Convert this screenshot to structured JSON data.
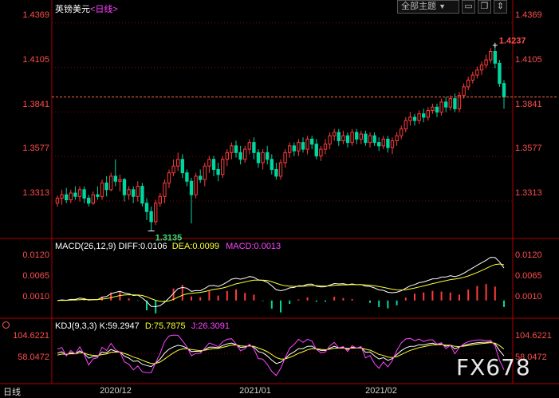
{
  "header": {
    "symbol": "英镑美元",
    "period": "<日线>",
    "theme_label": "全部主题",
    "theme_arrow": "▼",
    "btn_minus": "▭",
    "btn_copy": "❐",
    "btn_scroll": "⇕"
  },
  "footer": {
    "period_label": "日线"
  },
  "watermark": "FX678",
  "colors": {
    "up": "#ff3b3b",
    "down": "#00d6a0",
    "macd_white": "#ffffff",
    "macd_yellow": "#ffff33",
    "macd_magenta": "#ff44ff",
    "grid": "#8b0000",
    "axis_label": "#ff4d4d"
  },
  "chart_data": [
    {
      "type": "candlestick",
      "title": "英镑美元 <日线>",
      "yticks": [
        "1.4369",
        "1.4105",
        "1.3841",
        "1.3577",
        "1.3313"
      ],
      "ylim": [
        1.31,
        1.442
      ],
      "x_ticks": [
        "2020/12",
        "2021/01",
        "2021/02"
      ],
      "x_tick_index": [
        15,
        45,
        75
      ],
      "high_label": "1.4237",
      "low_label": "1.3135",
      "high_index": 98,
      "low_index": 21,
      "last_price": 1.393,
      "candles": [
        [
          1.33,
          1.333,
          1.328,
          1.3345
        ],
        [
          1.333,
          1.335,
          1.329,
          1.338
        ],
        [
          1.335,
          1.332,
          1.33,
          1.339
        ],
        [
          1.332,
          1.336,
          1.33,
          1.338
        ],
        [
          1.336,
          1.334,
          1.332,
          1.34
        ],
        [
          1.334,
          1.338,
          1.331,
          1.34
        ],
        [
          1.338,
          1.333,
          1.33,
          1.34
        ],
        [
          1.333,
          1.33,
          1.328,
          1.335
        ],
        [
          1.33,
          1.335,
          1.329,
          1.337
        ],
        [
          1.335,
          1.334,
          1.332,
          1.34
        ],
        [
          1.334,
          1.342,
          1.332,
          1.344
        ],
        [
          1.342,
          1.338,
          1.334,
          1.346
        ],
        [
          1.338,
          1.346,
          1.337,
          1.348
        ],
        [
          1.346,
          1.343,
          1.34,
          1.356
        ],
        [
          1.343,
          1.344,
          1.337,
          1.347
        ],
        [
          1.344,
          1.335,
          1.331,
          1.345
        ],
        [
          1.335,
          1.338,
          1.332,
          1.34
        ],
        [
          1.338,
          1.334,
          1.33,
          1.34
        ],
        [
          1.334,
          1.34,
          1.331,
          1.343
        ],
        [
          1.34,
          1.33,
          1.328,
          1.342
        ],
        [
          1.33,
          1.325,
          1.32,
          1.333
        ],
        [
          1.325,
          1.319,
          1.3135,
          1.328
        ],
        [
          1.319,
          1.33,
          1.317,
          1.332
        ],
        [
          1.33,
          1.334,
          1.328,
          1.336
        ],
        [
          1.334,
          1.342,
          1.33,
          1.344
        ],
        [
          1.342,
          1.348,
          1.339,
          1.35
        ],
        [
          1.348,
          1.352,
          1.346,
          1.356
        ],
        [
          1.352,
          1.356,
          1.349,
          1.36
        ],
        [
          1.356,
          1.348,
          1.345,
          1.359
        ],
        [
          1.348,
          1.343,
          1.34,
          1.35
        ],
        [
          1.343,
          1.335,
          1.318,
          1.345
        ],
        [
          1.335,
          1.346,
          1.333,
          1.348
        ],
        [
          1.346,
          1.344,
          1.342,
          1.35
        ],
        [
          1.344,
          1.352,
          1.34,
          1.354
        ],
        [
          1.352,
          1.356,
          1.348,
          1.358
        ],
        [
          1.356,
          1.35,
          1.346,
          1.358
        ],
        [
          1.35,
          1.347,
          1.343,
          1.354
        ],
        [
          1.347,
          1.356,
          1.345,
          1.358
        ],
        [
          1.356,
          1.36,
          1.352,
          1.362
        ],
        [
          1.36,
          1.364,
          1.356,
          1.366
        ],
        [
          1.364,
          1.36,
          1.357,
          1.367
        ],
        [
          1.36,
          1.356,
          1.353,
          1.364
        ],
        [
          1.356,
          1.362,
          1.354,
          1.364
        ],
        [
          1.362,
          1.366,
          1.359,
          1.368
        ],
        [
          1.366,
          1.36,
          1.356,
          1.369
        ],
        [
          1.36,
          1.354,
          1.351,
          1.362
        ],
        [
          1.354,
          1.36,
          1.35,
          1.362
        ],
        [
          1.36,
          1.356,
          1.353,
          1.364
        ],
        [
          1.356,
          1.35,
          1.347,
          1.359
        ],
        [
          1.35,
          1.346,
          1.344,
          1.354
        ],
        [
          1.346,
          1.354,
          1.344,
          1.356
        ],
        [
          1.354,
          1.36,
          1.351,
          1.362
        ],
        [
          1.36,
          1.364,
          1.357,
          1.366
        ],
        [
          1.364,
          1.361,
          1.358,
          1.366
        ],
        [
          1.361,
          1.366,
          1.358,
          1.368
        ],
        [
          1.366,
          1.362,
          1.36,
          1.369
        ],
        [
          1.362,
          1.368,
          1.359,
          1.37
        ],
        [
          1.368,
          1.365,
          1.362,
          1.37
        ],
        [
          1.365,
          1.358,
          1.356,
          1.368
        ],
        [
          1.358,
          1.362,
          1.355,
          1.364
        ],
        [
          1.362,
          1.365,
          1.359,
          1.368
        ],
        [
          1.365,
          1.37,
          1.362,
          1.372
        ],
        [
          1.37,
          1.372,
          1.367,
          1.374
        ],
        [
          1.372,
          1.367,
          1.364,
          1.374
        ],
        [
          1.367,
          1.37,
          1.365,
          1.373
        ],
        [
          1.37,
          1.366,
          1.363,
          1.372
        ],
        [
          1.366,
          1.372,
          1.364,
          1.374
        ],
        [
          1.372,
          1.368,
          1.365,
          1.374
        ],
        [
          1.368,
          1.371,
          1.365,
          1.373
        ],
        [
          1.371,
          1.366,
          1.364,
          1.373
        ],
        [
          1.366,
          1.37,
          1.363,
          1.372
        ],
        [
          1.37,
          1.366,
          1.364,
          1.372
        ],
        [
          1.366,
          1.364,
          1.361,
          1.369
        ],
        [
          1.364,
          1.368,
          1.362,
          1.37
        ],
        [
          1.368,
          1.363,
          1.36,
          1.37
        ],
        [
          1.363,
          1.367,
          1.359,
          1.369
        ],
        [
          1.367,
          1.37,
          1.364,
          1.372
        ],
        [
          1.37,
          1.374,
          1.368,
          1.376
        ],
        [
          1.374,
          1.379,
          1.372,
          1.381
        ],
        [
          1.379,
          1.381,
          1.376,
          1.384
        ],
        [
          1.381,
          1.379,
          1.376,
          1.383
        ],
        [
          1.379,
          1.383,
          1.377,
          1.385
        ],
        [
          1.383,
          1.381,
          1.378,
          1.386
        ],
        [
          1.381,
          1.385,
          1.379,
          1.387
        ],
        [
          1.385,
          1.387,
          1.383,
          1.389
        ],
        [
          1.387,
          1.384,
          1.381,
          1.389
        ],
        [
          1.384,
          1.39,
          1.382,
          1.392
        ],
        [
          1.39,
          1.387,
          1.384,
          1.393
        ],
        [
          1.387,
          1.392,
          1.385,
          1.394
        ],
        [
          1.392,
          1.386,
          1.384,
          1.395
        ],
        [
          1.386,
          1.394,
          1.384,
          1.396
        ],
        [
          1.394,
          1.399,
          1.392,
          1.401
        ],
        [
          1.399,
          1.403,
          1.397,
          1.405
        ],
        [
          1.403,
          1.406,
          1.401,
          1.408
        ],
        [
          1.406,
          1.409,
          1.404,
          1.411
        ],
        [
          1.409,
          1.412,
          1.406,
          1.414
        ],
        [
          1.412,
          1.415,
          1.41,
          1.418
        ],
        [
          1.415,
          1.42,
          1.413,
          1.422
        ],
        [
          1.42,
          1.413,
          1.41,
          1.4237
        ],
        [
          1.413,
          1.401,
          1.399,
          1.415
        ],
        [
          1.401,
          1.393,
          1.386,
          1.403
        ]
      ]
    },
    {
      "type": "macd",
      "title": "MACD(26,12,9)",
      "diff_label": "DIFF:0.0106",
      "dea_label": "DEA:0.0099",
      "macd_label": "MACD:0.0013",
      "yticks": [
        "0.0120",
        "0.0065",
        "0.0010"
      ]
    },
    {
      "type": "kdj",
      "title": "KDJ(9,3,3)",
      "k_label": "K:59.2947",
      "d_label": "D:75.7875",
      "j_label": "J:26.3091",
      "yticks": [
        "104.6221",
        "58.0472"
      ]
    }
  ]
}
